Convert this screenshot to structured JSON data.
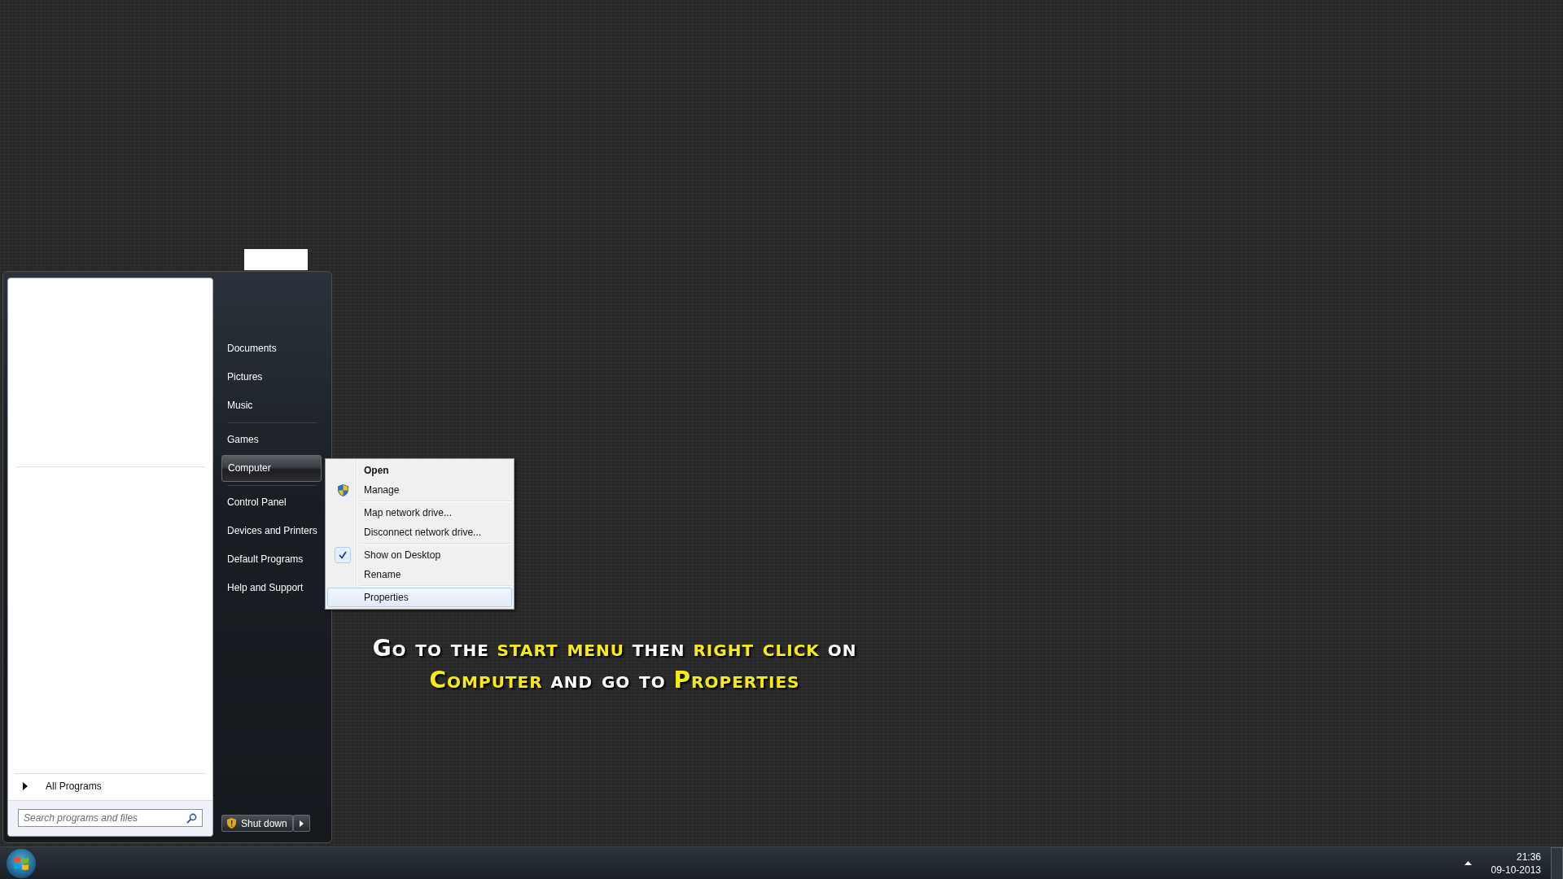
{
  "start_menu": {
    "right_item_groups": [
      [
        {
          "label": "Documents",
          "selected": false
        },
        {
          "label": "Pictures",
          "selected": false
        },
        {
          "label": "Music",
          "selected": false
        }
      ],
      [
        {
          "label": "Games",
          "selected": false
        },
        {
          "label": "Computer",
          "selected": true
        }
      ],
      [
        {
          "label": "Control Panel",
          "selected": false
        },
        {
          "label": "Devices and Printers",
          "selected": false
        },
        {
          "label": "Default Programs",
          "selected": false
        },
        {
          "label": "Help and Support",
          "selected": false
        }
      ]
    ],
    "all_programs": "All Programs",
    "search": {
      "placeholder": "Search programs and files"
    },
    "shutdown": "Shut down"
  },
  "context_menu": {
    "groups": [
      [
        {
          "label": "Open",
          "kind": "default",
          "checked": false,
          "selected": false
        },
        {
          "label": "Manage",
          "kind": "shield",
          "checked": false,
          "selected": false
        }
      ],
      [
        {
          "label": "Map network drive...",
          "kind": "plain",
          "checked": false,
          "selected": false
        },
        {
          "label": "Disconnect network drive...",
          "kind": "plain",
          "checked": false,
          "selected": false
        }
      ],
      [
        {
          "label": "Show on Desktop",
          "kind": "plain",
          "checked": true,
          "selected": false
        },
        {
          "label": "Rename",
          "kind": "plain",
          "checked": false,
          "selected": false
        }
      ],
      [
        {
          "label": "Properties",
          "kind": "plain",
          "checked": false,
          "selected": true
        }
      ]
    ]
  },
  "caption": {
    "lines": [
      [
        {
          "text": "Go to the",
          "highlight": false
        },
        {
          "text": "start menu",
          "highlight": true
        },
        {
          "text": "then",
          "highlight": false
        },
        {
          "text": "right click",
          "highlight": true
        },
        {
          "text": "on",
          "highlight": false
        }
      ],
      [
        {
          "text": "Computer",
          "highlight": true
        },
        {
          "text": "and go to",
          "highlight": false
        },
        {
          "text": "Properties",
          "highlight": true
        }
      ]
    ]
  },
  "clock": {
    "time": "21:36",
    "date": "09-10-2013"
  }
}
